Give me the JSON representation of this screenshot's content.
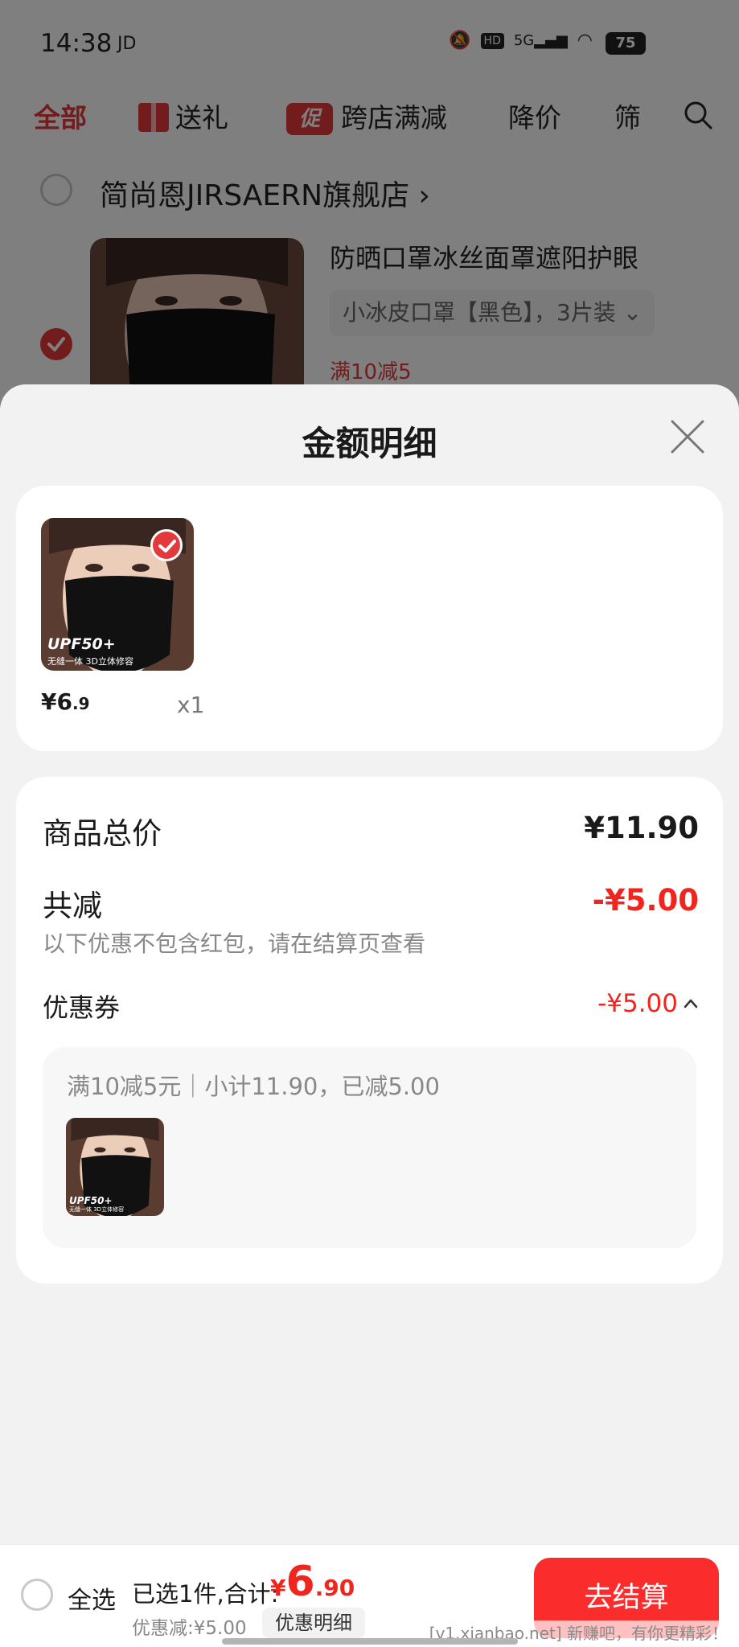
{
  "status_bar": {
    "time": "14:38",
    "carrier": "JD",
    "network": "5G",
    "hd": "HD",
    "battery": "75"
  },
  "top_tabs": {
    "all": "全部",
    "gift": "送礼",
    "promo_badge": "促",
    "cross_store": "跨店满减",
    "price_drop": "降价",
    "filter": "筛"
  },
  "store": {
    "name": "简尚恩JIRSAERN旗舰店 ›",
    "item_title": "防晒口罩冰丝面罩遮阳护眼",
    "item_spec": "小冰皮口罩【黑色】，3片装 ⌄",
    "item_promo": "满10减5"
  },
  "sheet": {
    "title": "金额明细",
    "product": {
      "upf": "UPF50+",
      "upf_sub": "无缝一体 3D立体修容",
      "price_symbol": "¥",
      "price_int": "6",
      "price_dec": ".9",
      "qty": "x1"
    },
    "summary": {
      "total_label": "商品总价",
      "total_value": "¥11.90",
      "reduce_label": "共减",
      "reduce_value": "-¥5.00",
      "reduce_note": "以下优惠不包含红包，请在结算页查看",
      "coupon_label": "优惠券",
      "coupon_value": "-¥5.00",
      "coupon_detail": "满10减5元｜小计11.90，已减5.00"
    }
  },
  "bottom_bar": {
    "select_all": "全选",
    "selected_text": "已选1件,合计:",
    "total_symbol": "¥",
    "total_int": "6",
    "total_dec": ".90",
    "discount_text": "优惠减:¥5.00",
    "detail_button": "优惠明细",
    "checkout_button": "去结算",
    "watermark": "[v1.xianbao.net] 新赚吧，有你更精彩！"
  },
  "colors": {
    "accent_red": "#e4393c",
    "price_red": "#f0251e",
    "checkout_red": "#fa2c2c"
  }
}
